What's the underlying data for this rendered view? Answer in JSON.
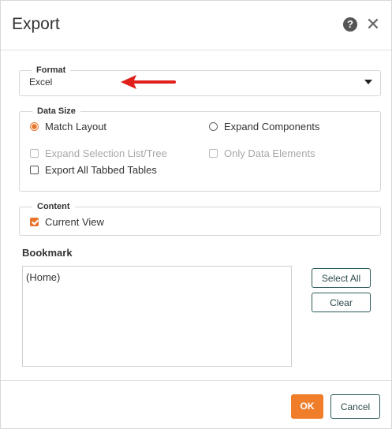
{
  "dialog": {
    "title": "Export",
    "help_icon": "help-icon",
    "close_icon": "close-icon"
  },
  "format": {
    "legend": "Format",
    "selected": "Excel"
  },
  "data_size": {
    "legend": "Data Size",
    "match_layout": "Match Layout",
    "expand_components": "Expand Components",
    "expand_selection": "Expand Selection List/Tree",
    "only_data_elements": "Only Data Elements",
    "export_all_tabbed": "Export All Tabbed Tables"
  },
  "content": {
    "legend": "Content",
    "current_view": "Current View"
  },
  "bookmark": {
    "label": "Bookmark",
    "items": [
      "(Home)"
    ],
    "select_all": "Select All",
    "clear": "Clear"
  },
  "footer": {
    "ok": "OK",
    "cancel": "Cancel"
  },
  "colors": {
    "accent": "#ef7d2a",
    "annotation_arrow": "#e0201b",
    "button_border": "#2c5a5a"
  }
}
